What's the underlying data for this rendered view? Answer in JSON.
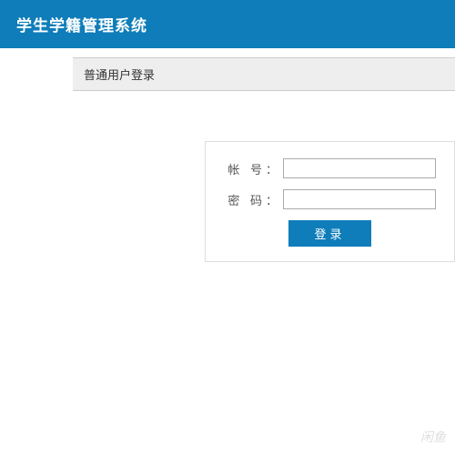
{
  "header": {
    "title": "学生学籍管理系统"
  },
  "panel": {
    "title": "普通用户登录"
  },
  "form": {
    "account_label": "帐 号：",
    "account_value": "",
    "password_label": "密 码：",
    "password_value": "",
    "login_button": "登录"
  },
  "watermark": "闲鱼"
}
